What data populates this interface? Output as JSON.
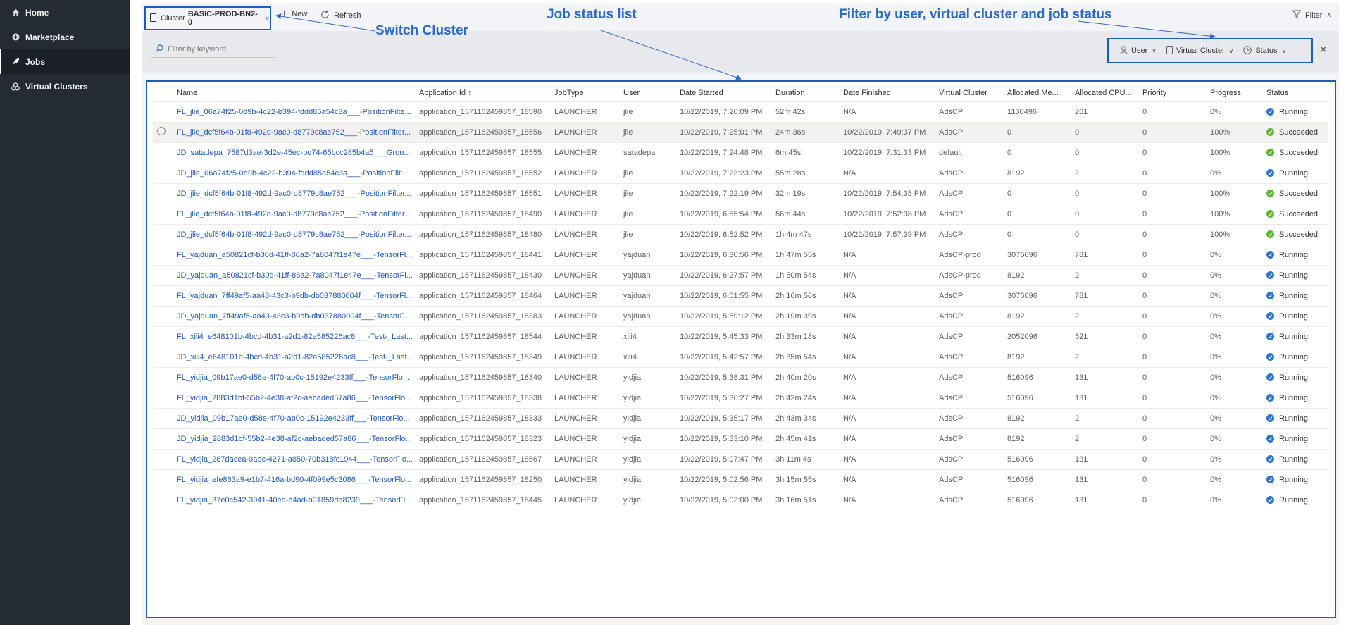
{
  "sidebar": {
    "items": [
      {
        "label": "Home",
        "icon": "home-icon",
        "active": false
      },
      {
        "label": "Marketplace",
        "icon": "plus-circle-icon",
        "active": false
      },
      {
        "label": "Jobs",
        "icon": "rocket-icon",
        "active": true
      },
      {
        "label": "Virtual Clusters",
        "icon": "cluster-icon",
        "active": false
      }
    ]
  },
  "toolbar": {
    "cluster_label": "Cluster",
    "cluster_value": "BASIC-PROD-BN2-0",
    "new_label": "New",
    "refresh_label": "Refresh",
    "filter_label": "Filter"
  },
  "filters": {
    "keyword_placeholder": "Filter by keyword",
    "user_label": "User",
    "vc_label": "Virtual Cluster",
    "status_label": "Status"
  },
  "annotations": {
    "switch_cluster": "Switch Cluster",
    "job_status_list": "Job status list",
    "filter_note": "Filter by user, virtual cluster and job status"
  },
  "colors": {
    "accent": "#1f5bb8",
    "running": "#2b76d1",
    "succeeded": "#5cb531",
    "sidebar_bg": "#252b33"
  },
  "table": {
    "headers": [
      "Name",
      "Application Id ↑",
      "JobType",
      "User",
      "Date Started",
      "Duration",
      "Date Finished",
      "Virtual Cluster",
      "Allocated Me...",
      "Allocated CPU...",
      "Priority",
      "Progress",
      "Status"
    ],
    "rows": [
      [
        "FL_jlie_06a74f25-0d9b-4c22-b394-fddd85a54c3a___-PositionFilte...",
        "application_1571162459857_18590",
        "LAUNCHER",
        "jlie",
        "10/22/2019, 7:26:09 PM",
        "52m 42s",
        "N/A",
        "AdsCP",
        "1130496",
        "261",
        "0",
        "0%",
        "Running"
      ],
      [
        "FL_jlie_dcf5f64b-01f8-492d-9ac0-d8779c8ae752___-PositionFilter...",
        "application_1571162459857_18556",
        "LAUNCHER",
        "jlie",
        "10/22/2019, 7:25:01 PM",
        "24m 36s",
        "10/22/2019, 7:49:37 PM",
        "AdsCP",
        "0",
        "0",
        "0",
        "100%",
        "Succeeded"
      ],
      [
        "JD_satadepa_7587d3ae-3d2e-45ec-bd74-65bcc285b4a5___Grou...",
        "application_1571162459857_18555",
        "LAUNCHER",
        "satadepa",
        "10/22/2019, 7:24:48 PM",
        "6m 45s",
        "10/22/2019, 7:31:33 PM",
        "default",
        "0",
        "0",
        "0",
        "100%",
        "Succeeded"
      ],
      [
        "JD_jlie_06a74f25-0d9b-4c22-b394-fddd85a54c3a___-PositionFilt...",
        "application_1571162459857_18552",
        "LAUNCHER",
        "jlie",
        "10/22/2019, 7:23:23 PM",
        "55m 28s",
        "N/A",
        "AdsCP",
        "8192",
        "2",
        "0",
        "0%",
        "Running"
      ],
      [
        "JD_jlie_dcf5f64b-01f8-492d-9ac0-d8779c8ae752___-PositionFilter...",
        "application_1571162459857_18551",
        "LAUNCHER",
        "jlie",
        "10/22/2019, 7:22:19 PM",
        "32m 19s",
        "10/22/2019, 7:54:38 PM",
        "AdsCP",
        "0",
        "0",
        "0",
        "100%",
        "Succeeded"
      ],
      [
        "FL_jlie_dcf5f64b-01f8-492d-9ac0-d8779c8ae752___-PositionFilter...",
        "application_1571162459857_18490",
        "LAUNCHER",
        "jlie",
        "10/22/2019, 6:55:54 PM",
        "56m 44s",
        "10/22/2019, 7:52:38 PM",
        "AdsCP",
        "0",
        "0",
        "0",
        "100%",
        "Succeeded"
      ],
      [
        "JD_jlie_dcf5f64b-01f8-492d-9ac0-d8779c8ae752___-PositionFilter...",
        "application_1571162459857_18480",
        "LAUNCHER",
        "jlie",
        "10/22/2019, 6:52:52 PM",
        "1h 4m 47s",
        "10/22/2019, 7:57:39 PM",
        "AdsCP",
        "0",
        "0",
        "0",
        "100%",
        "Succeeded"
      ],
      [
        "FL_yajduan_a50821cf-b30d-41ff-86a2-7a8047f1e47e___-TensorFl...",
        "application_1571162459857_18441",
        "LAUNCHER",
        "yajduan",
        "10/22/2019, 6:30:56 PM",
        "1h 47m 55s",
        "N/A",
        "AdsCP-prod",
        "3076096",
        "781",
        "0",
        "0%",
        "Running"
      ],
      [
        "JD_yajduan_a50821cf-b30d-41ff-86a2-7a8047f1e47e___-TensorFl...",
        "application_1571162459857_18430",
        "LAUNCHER",
        "yajduan",
        "10/22/2019, 6:27:57 PM",
        "1h 50m 54s",
        "N/A",
        "AdsCP-prod",
        "8192",
        "2",
        "0",
        "0%",
        "Running"
      ],
      [
        "FL_yajduan_7ff49af5-aa43-43c3-b9db-db037880004f___-TensorFl...",
        "application_1571162459857_18464",
        "LAUNCHER",
        "yajduan",
        "10/22/2019, 6:01:55 PM",
        "2h 16m 56s",
        "N/A",
        "AdsCP",
        "3076096",
        "781",
        "0",
        "0%",
        "Running"
      ],
      [
        "JD_yajduan_7ff49af5-aa43-43c3-b9db-db037880004f___-TensorF...",
        "application_1571162459857_18383",
        "LAUNCHER",
        "yajduan",
        "10/22/2019, 5:59:12 PM",
        "2h 19m 39s",
        "N/A",
        "AdsCP",
        "8192",
        "2",
        "0",
        "0%",
        "Running"
      ],
      [
        "FL_xili4_e648101b-4bcd-4b31-a2d1-82a585226ac8___-Test-_Last...",
        "application_1571162459857_18544",
        "LAUNCHER",
        "xili4",
        "10/22/2019, 5:45:33 PM",
        "2h 33m 18s",
        "N/A",
        "AdsCP",
        "2052096",
        "521",
        "0",
        "0%",
        "Running"
      ],
      [
        "JD_xili4_e648101b-4bcd-4b31-a2d1-82a585226ac8___-Test-_Last...",
        "application_1571162459857_18349",
        "LAUNCHER",
        "xili4",
        "10/22/2019, 5:42:57 PM",
        "2h 35m 54s",
        "N/A",
        "AdsCP",
        "8192",
        "2",
        "0",
        "0%",
        "Running"
      ],
      [
        "FL_yidjia_09b17ae0-d58e-4f70-ab0c-15192e4233ff___-TensorFlo...",
        "application_1571162459857_18340",
        "LAUNCHER",
        "yidjia",
        "10/22/2019, 5:38:31 PM",
        "2h 40m 20s",
        "N/A",
        "AdsCP",
        "516096",
        "131",
        "0",
        "0%",
        "Running"
      ],
      [
        "FL_yidjia_2883d1bf-55b2-4e38-af2c-aebaded57a86___-TensorFlo...",
        "application_1571162459857_18338",
        "LAUNCHER",
        "yidjia",
        "10/22/2019, 5:36:27 PM",
        "2h 42m 24s",
        "N/A",
        "AdsCP",
        "516096",
        "131",
        "0",
        "0%",
        "Running"
      ],
      [
        "JD_yidjia_09b17ae0-d58e-4f70-ab0c-15192e4233ff___-TensorFlo...",
        "application_1571162459857_18333",
        "LAUNCHER",
        "yidjia",
        "10/22/2019, 5:35:17 PM",
        "2h 43m 34s",
        "N/A",
        "AdsCP",
        "8192",
        "2",
        "0",
        "0%",
        "Running"
      ],
      [
        "JD_yidjia_2883d1bf-55b2-4e38-af2c-aebaded57a86___-TensorFlo...",
        "application_1571162459857_18323",
        "LAUNCHER",
        "yidjia",
        "10/22/2019, 5:33:10 PM",
        "2h 45m 41s",
        "N/A",
        "AdsCP",
        "8192",
        "2",
        "0",
        "0%",
        "Running"
      ],
      [
        "FL_yidjia_287dacea-9abc-4271-a850-70b318fc1944___-TensorFlo...",
        "application_1571162459857_18567",
        "LAUNCHER",
        "yidjia",
        "10/22/2019, 5:07:47 PM",
        "3h 11m 4s",
        "N/A",
        "AdsCP",
        "516096",
        "131",
        "0",
        "0%",
        "Running"
      ],
      [
        "FL_yidjia_efe863a9-e1b7-416a-bd90-4f099e5c3086___-TensorFlo...",
        "application_1571162459857_18250",
        "LAUNCHER",
        "yidjia",
        "10/22/2019, 5:02:56 PM",
        "3h 15m 55s",
        "N/A",
        "AdsCP",
        "516096",
        "131",
        "0",
        "0%",
        "Running"
      ],
      [
        "FL_yidjia_37e0c542-3941-40ed-b4ad-b01859de8239___-TensorFl...",
        "application_1571162459857_18445",
        "LAUNCHER",
        "yidjia",
        "10/22/2019, 5:02:00 PM",
        "3h 16m 51s",
        "N/A",
        "AdsCP",
        "516096",
        "131",
        "0",
        "0%",
        "Running"
      ]
    ]
  }
}
